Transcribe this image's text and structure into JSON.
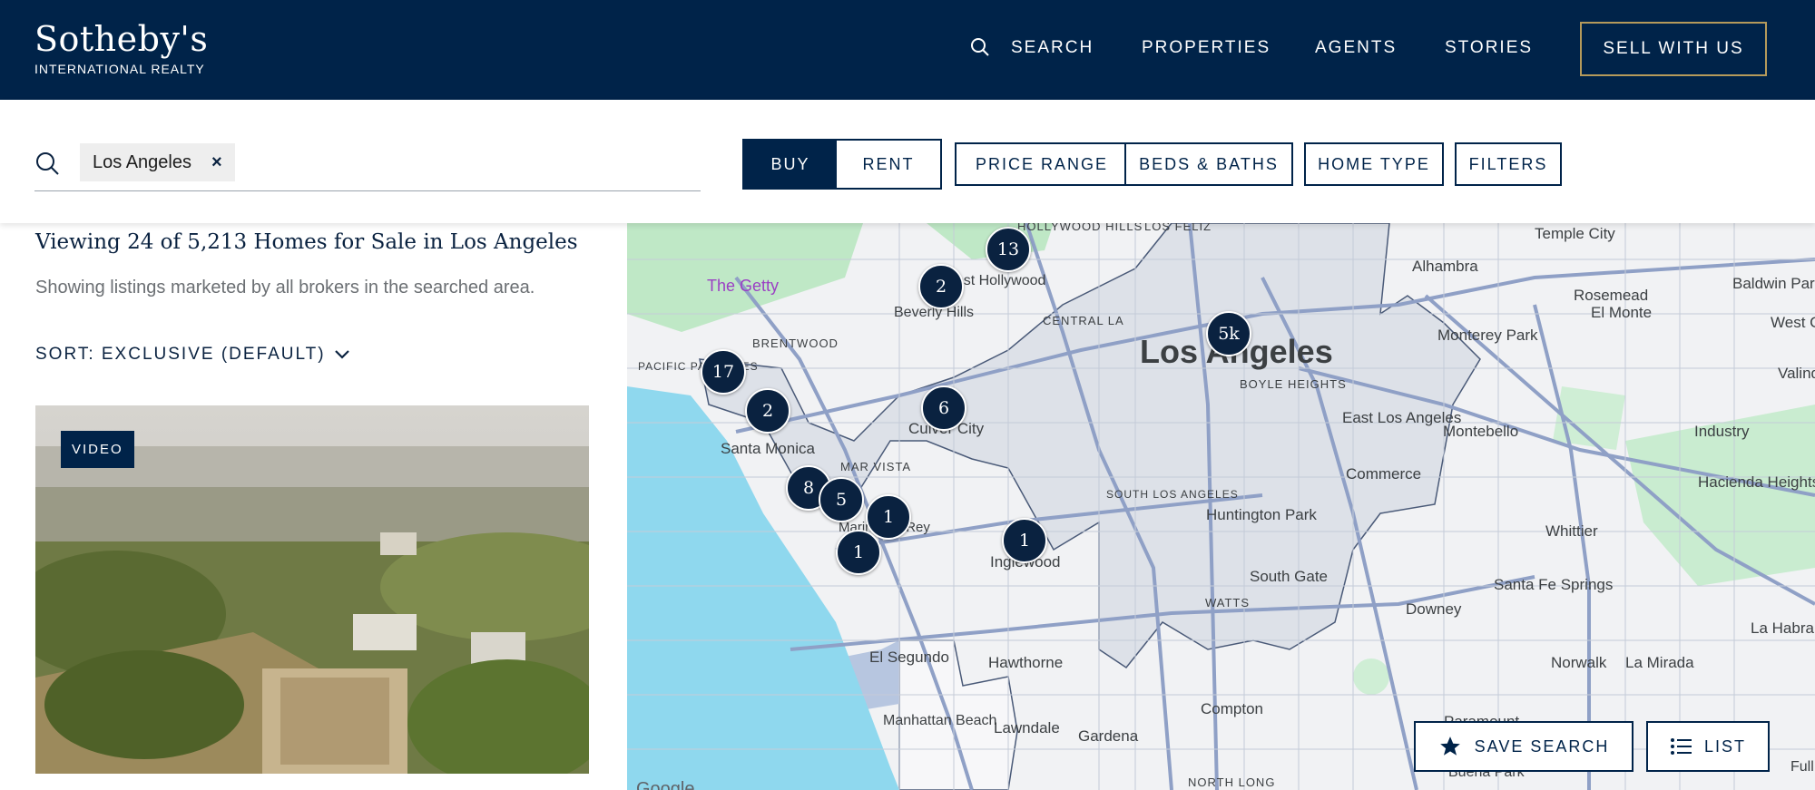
{
  "header": {
    "logo_main": "Sotheby's",
    "logo_sub": "INTERNATIONAL REALTY",
    "nav": [
      "SEARCH",
      "PROPERTIES",
      "AGENTS",
      "STORIES"
    ],
    "sell_label": "SELL WITH US"
  },
  "search": {
    "chip": "Los Angeles",
    "chip_close": "×",
    "buy": "BUY",
    "rent": "RENT",
    "filters": [
      "PRICE RANGE",
      "BEDS & BATHS",
      "HOME TYPE",
      "FILTERS"
    ]
  },
  "results": {
    "title": "Viewing 24 of 5,213 Homes for Sale in Los Angeles",
    "subtitle": "Showing listings marketed by all brokers in the searched area.",
    "sort": "SORT: EXCLUSIVE (DEFAULT)",
    "video_badge": "VIDEO"
  },
  "map": {
    "city_label": "Los Angeles",
    "clusters": [
      "13",
      "2",
      "5k",
      "17",
      "2",
      "6",
      "8",
      "5",
      "1",
      "1",
      "1"
    ],
    "place_labels": [
      "HOLLYWOOD HILLS",
      "LOS FELIZ",
      "Temple City",
      "Alhambra",
      "Baldwin Park",
      "The Getty",
      "West Hollywood",
      "Beverly Hills",
      "Rosemead",
      "El Monte",
      "West Cov",
      "CENTRAL LA",
      "Monterey Park",
      "BRENTWOOD",
      "BOYLE HEIGHTS",
      "Valinda",
      "PACIFIC PALISADES",
      "East Los Angeles",
      "Montebello",
      "Industry",
      "Santa Monica",
      "Culver City",
      "MAR VISTA",
      "Commerce",
      "Hacienda Heights",
      "Marina del Rey",
      "SOUTH LOS ANGELES",
      "Huntington Park",
      "Whittier",
      "Inglewood",
      "South Gate",
      "WATTS",
      "Santa Fe Springs",
      "Downey",
      "El Segundo",
      "Hawthorne",
      "La Habra",
      "Norwalk",
      "La Mirada",
      "Compton",
      "Paramount",
      "Manhattan Beach",
      "Lawndale",
      "Gardena",
      "NORTH LONG",
      "Buena Park",
      "Full"
    ],
    "save_search": "SAVE SEARCH",
    "list": "LIST",
    "google": "Google"
  },
  "colors": {
    "navy": "#002349",
    "gold": "#b59a5b",
    "water": "#8fd8ee",
    "park": "#bfe8c6"
  }
}
